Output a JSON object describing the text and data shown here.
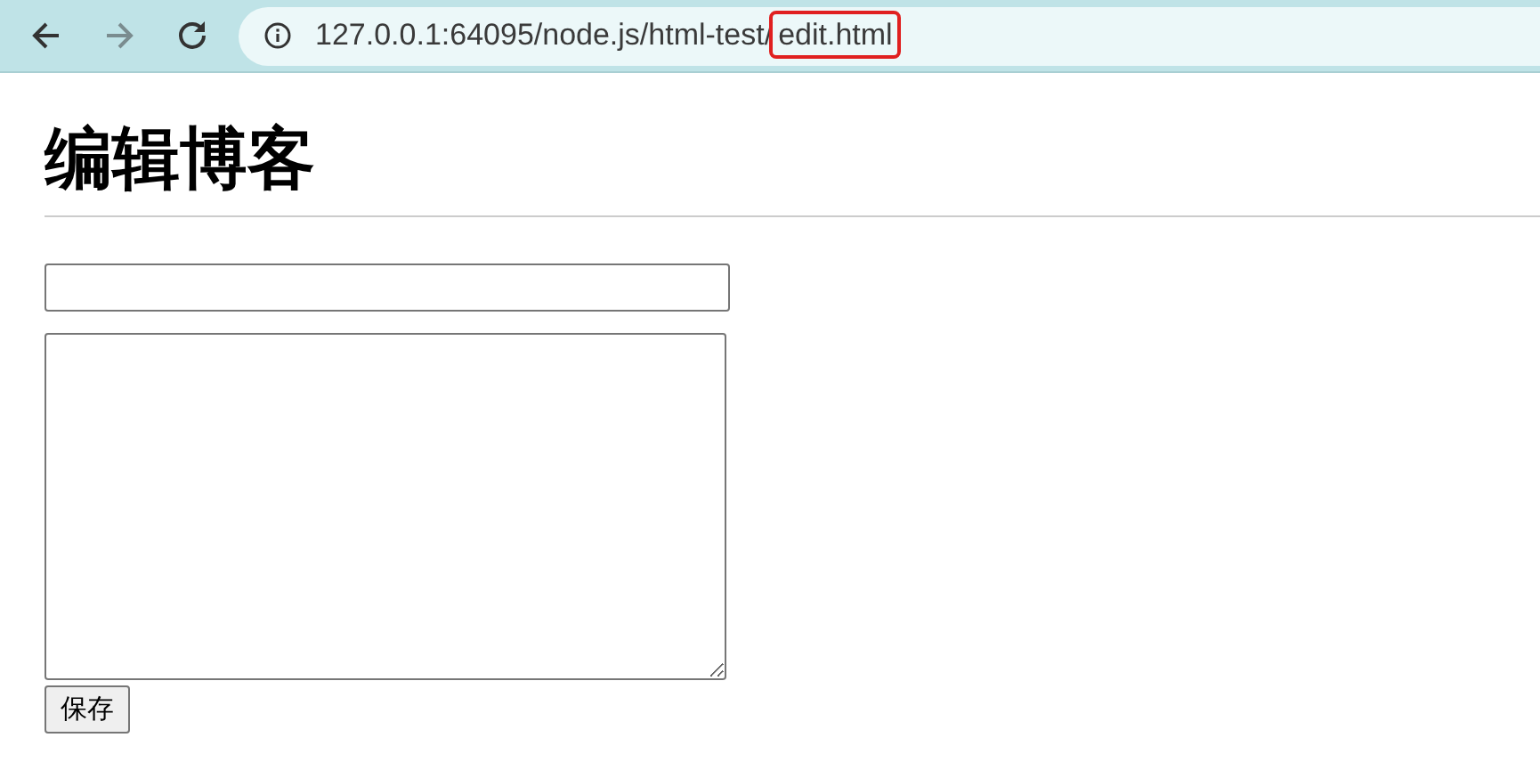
{
  "browser": {
    "back_disabled": false,
    "forward_disabled": true,
    "url_parts": [
      {
        "text": "127.0.0.1:64095/node.js/html-test/",
        "highlighted": false
      },
      {
        "text": "edit.html",
        "highlighted": true
      }
    ]
  },
  "page": {
    "heading": "编辑博客",
    "save_button": "保存"
  }
}
